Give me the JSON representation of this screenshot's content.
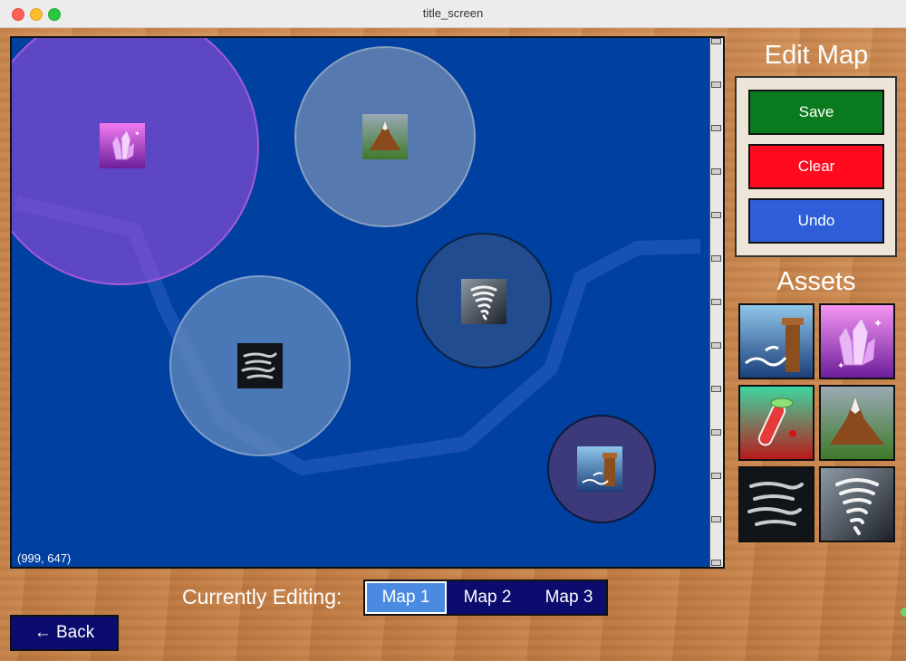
{
  "window": {
    "title": "title_screen"
  },
  "map": {
    "cursor_coords": "(999, 647)"
  },
  "sidebar": {
    "edit_title": "Edit Map",
    "buttons": {
      "save": "Save",
      "clear": "Clear",
      "undo": "Undo"
    },
    "button_colors": {
      "save": "#0a7a1e",
      "clear": "#ff0a1e",
      "undo": "#2e5fd8"
    },
    "assets_title": "Assets",
    "assets": [
      "water-tower-icon",
      "crystal-icon",
      "potion-icon",
      "mountain-icon",
      "wind-icon",
      "tornado-icon"
    ]
  },
  "bottom": {
    "editing_label": "Currently Editing:",
    "map_tabs": [
      "Map 1",
      "Map 2",
      "Map 3"
    ],
    "active_tab": "Map 1",
    "back_label": "← Back"
  },
  "colors": {
    "map_bg": "#0040a0",
    "tab_bg": "#0c0c6e",
    "tab_active": "#4a8ae0"
  }
}
